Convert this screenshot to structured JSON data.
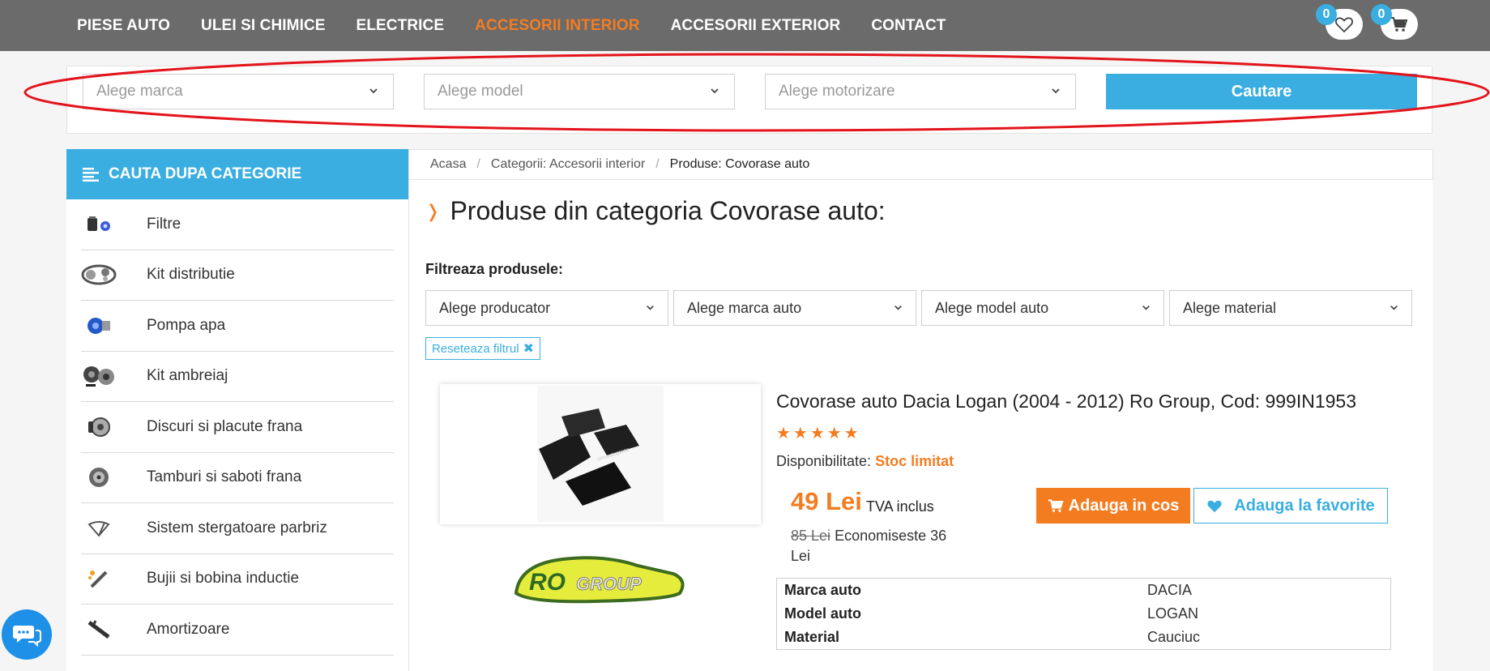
{
  "nav": {
    "items": [
      {
        "label": "PIESE AUTO"
      },
      {
        "label": "ULEI SI CHIMICE"
      },
      {
        "label": "ELECTRICE"
      },
      {
        "label": "ACCESORII INTERIOR"
      },
      {
        "label": "ACCESORII EXTERIOR"
      },
      {
        "label": "CONTACT"
      }
    ],
    "active_color": "#f47c20",
    "wishlist_count": "0",
    "cart_count": "0"
  },
  "search": {
    "brand_placeholder": "Alege marca",
    "model_placeholder": "Alege model",
    "engine_placeholder": "Alege motorizare",
    "button_label": "Cautare",
    "accent": "#3aaee0"
  },
  "sidebar": {
    "title": "CAUTA DUPA CATEGORIE",
    "items": [
      {
        "label": "Filtre",
        "icon": "filter-icon"
      },
      {
        "label": "Kit distributie",
        "icon": "timing-kit-icon"
      },
      {
        "label": "Pompa apa",
        "icon": "water-pump-icon"
      },
      {
        "label": "Kit ambreiaj",
        "icon": "clutch-kit-icon"
      },
      {
        "label": "Discuri si placute frana",
        "icon": "brake-disc-icon"
      },
      {
        "label": "Tamburi si saboti frana",
        "icon": "brake-drum-icon"
      },
      {
        "label": "Sistem stergatoare parbriz",
        "icon": "wiper-icon"
      },
      {
        "label": "Bujii si bobina inductie",
        "icon": "spark-plug-icon"
      },
      {
        "label": "Amortizoare",
        "icon": "shock-absorber-icon"
      }
    ]
  },
  "breadcrumb": {
    "home": "Acasa",
    "category": "Categorii: Accesorii interior",
    "current": "Produse: Covorase auto"
  },
  "page": {
    "title": "Produse din categoria Covorase auto:",
    "filter_label": "Filtreaza produsele:",
    "filters": [
      {
        "label": "Alege producator"
      },
      {
        "label": "Alege marca auto"
      },
      {
        "label": "Alege model auto"
      },
      {
        "label": "Alege material"
      }
    ],
    "reset_label": "Reseteaza filtrul"
  },
  "product": {
    "title": "Covorase auto Dacia Logan (2004 - 2012) Ro Group, Cod: 999IN1953",
    "rating": 5,
    "availability_label": "Disponibilitate:",
    "availability_value": "Stoc limitat",
    "price": "49 Lei",
    "tva": "TVA inclus",
    "old_price": "85 Lei",
    "savings": "Economiseste 36 Lei",
    "add_to_cart": "Adauga in cos",
    "add_to_favorites": "Adauga la favorite",
    "brand_logo_text": "RO GROUP",
    "specs": [
      {
        "key": "Marca auto",
        "value": "DACIA"
      },
      {
        "key": "Model auto",
        "value": "LOGAN"
      },
      {
        "key": "Material",
        "value": "Cauciuc"
      }
    ]
  }
}
